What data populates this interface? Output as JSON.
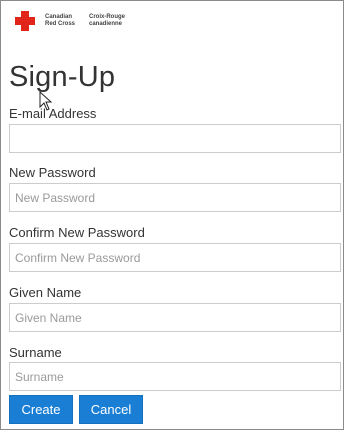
{
  "brand": {
    "name_en": "Canadian Red Cross",
    "name_fr": "Croix-Rouge canadienne",
    "cross_color": "#e1251b"
  },
  "page": {
    "title": "Sign-Up"
  },
  "form": {
    "email": {
      "label": "E-mail Address",
      "value": "",
      "placeholder": ""
    },
    "new_password": {
      "label": "New Password",
      "value": "",
      "placeholder": "New Password"
    },
    "confirm_password": {
      "label": "Confirm New Password",
      "value": "",
      "placeholder": "Confirm New Password"
    },
    "given_name": {
      "label": "Given Name",
      "value": "",
      "placeholder": "Given Name"
    },
    "surname": {
      "label": "Surname",
      "value": "",
      "placeholder": "Surname"
    }
  },
  "actions": {
    "create_label": "Create",
    "cancel_label": "Cancel",
    "button_color": "#1a7fd4"
  }
}
